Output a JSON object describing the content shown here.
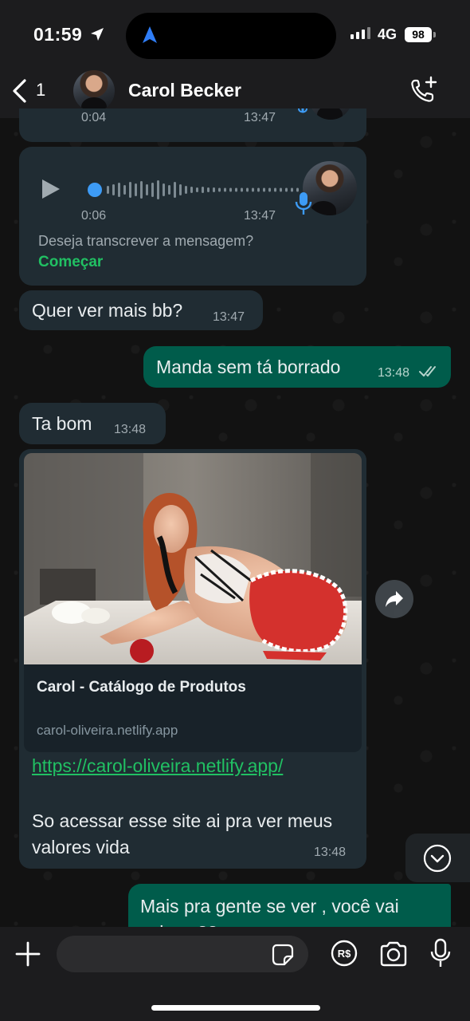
{
  "status_bar": {
    "time": "01:59",
    "network": "4G",
    "battery": "98"
  },
  "header": {
    "back_count": "1",
    "contact_name": "Carol Becker"
  },
  "messages": {
    "voice_partial": {
      "duration": "0:04",
      "time": "13:47"
    },
    "voice": {
      "duration": "0:06",
      "time": "13:47",
      "transcribe_prompt": "Deseja transcrever a mensagem?",
      "transcribe_action": "Começar"
    },
    "msg1": {
      "text": "Quer ver mais bb?",
      "time": "13:47"
    },
    "msg2": {
      "text": "Manda sem tá borrado",
      "time": "13:48"
    },
    "msg3": {
      "text": "Ta bom",
      "time": "13:48"
    },
    "link_msg": {
      "preview_title": "Carol - Catálogo de Produtos",
      "preview_domain": "carol-oliveira.netlify.app",
      "url": "https://carol-oliveira.netlify.app/",
      "body": "So acessar esse site ai pra ver meus valores vida",
      "time": "13:48"
    },
    "msg4": {
      "text": "Mais pra gente se ver , você vai cobrar ??"
    }
  },
  "input": {
    "placeholder": ""
  },
  "icons": {
    "location": "location-arrow-icon",
    "back": "chevron-left-icon",
    "call": "call-add-icon",
    "play": "play-icon",
    "mic": "mic-icon",
    "ticks": "double-check-icon",
    "forward": "forward-icon",
    "scroll": "chevron-down-circle-icon",
    "plus": "plus-icon",
    "sticker": "sticker-icon",
    "pix": "pix-icon",
    "camera": "camera-icon"
  },
  "colors": {
    "incoming_bubble": "#202c33",
    "outgoing_bubble": "#005c4b",
    "accent_green": "#21c063",
    "voice_blue": "#3d9bf5"
  }
}
